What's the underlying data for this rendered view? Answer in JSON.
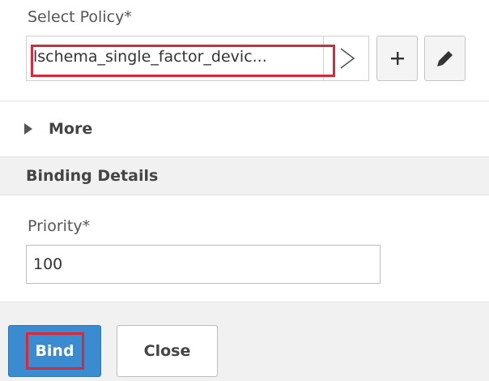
{
  "policy": {
    "label": "Select Policy*",
    "value": "lschema_single_factor_devic...",
    "add_icon": "plus-icon",
    "edit_icon": "pencil-icon",
    "expand_icon": "chevron-right-icon"
  },
  "more": {
    "label": "More",
    "icon": "caret-right-icon"
  },
  "binding_details": {
    "title": "Binding Details",
    "priority_label": "Priority*",
    "priority_value": "100"
  },
  "footer": {
    "bind_label": "Bind",
    "close_label": "Close"
  },
  "colors": {
    "primary": "#3b8bd1",
    "highlight": "#d42a3a",
    "section_bg": "#f1f1f1"
  }
}
